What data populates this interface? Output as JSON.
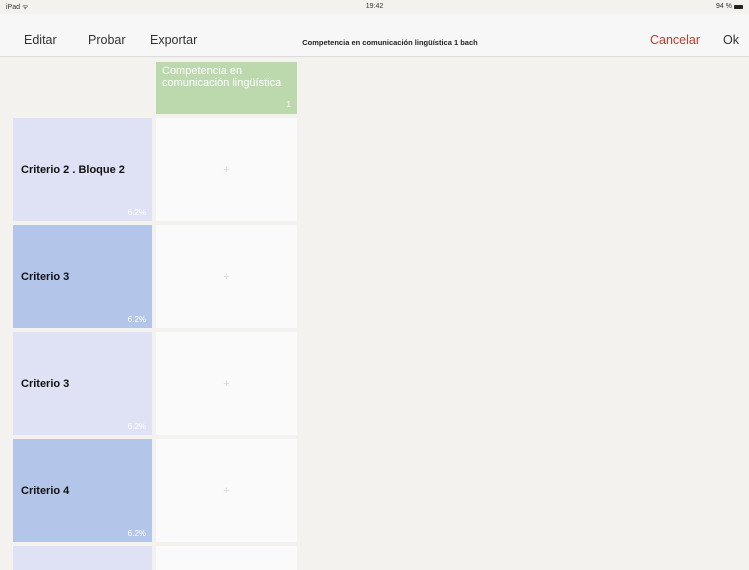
{
  "status_bar": {
    "device": "iPad ᯤ",
    "time": "19:42",
    "battery": "94 %"
  },
  "navbar": {
    "edit_label": "Editar",
    "test_label": "Probar",
    "export_label": "Exportar",
    "title": "Competencia en comunicación lingüística 1 bach",
    "cancel_label": "Cancelar",
    "ok_label": "Ok",
    "cancel_color": "#c0392b"
  },
  "table": {
    "column": {
      "label": "Competencia en comunicación lingüística",
      "number": "1"
    },
    "rows": [
      {
        "label": "Criterio 2 . Bloque 2",
        "percent": "6.2%",
        "cell_icon": "plus-icon",
        "cell_symbol": "+"
      },
      {
        "label": "Criterio 3",
        "percent": "6.2%",
        "cell_icon": "plus-icon",
        "cell_symbol": "+"
      },
      {
        "label": "Criterio 3",
        "percent": "6.2%",
        "cell_icon": "plus-icon",
        "cell_symbol": "+"
      },
      {
        "label": "Criterio 4",
        "percent": "6.2%",
        "cell_icon": "plus-icon",
        "cell_symbol": "+"
      }
    ]
  },
  "colors": {
    "header_green": "#bcd9ae",
    "row_light": "#dfe1f5",
    "row_dark": "#b3c6ea"
  }
}
